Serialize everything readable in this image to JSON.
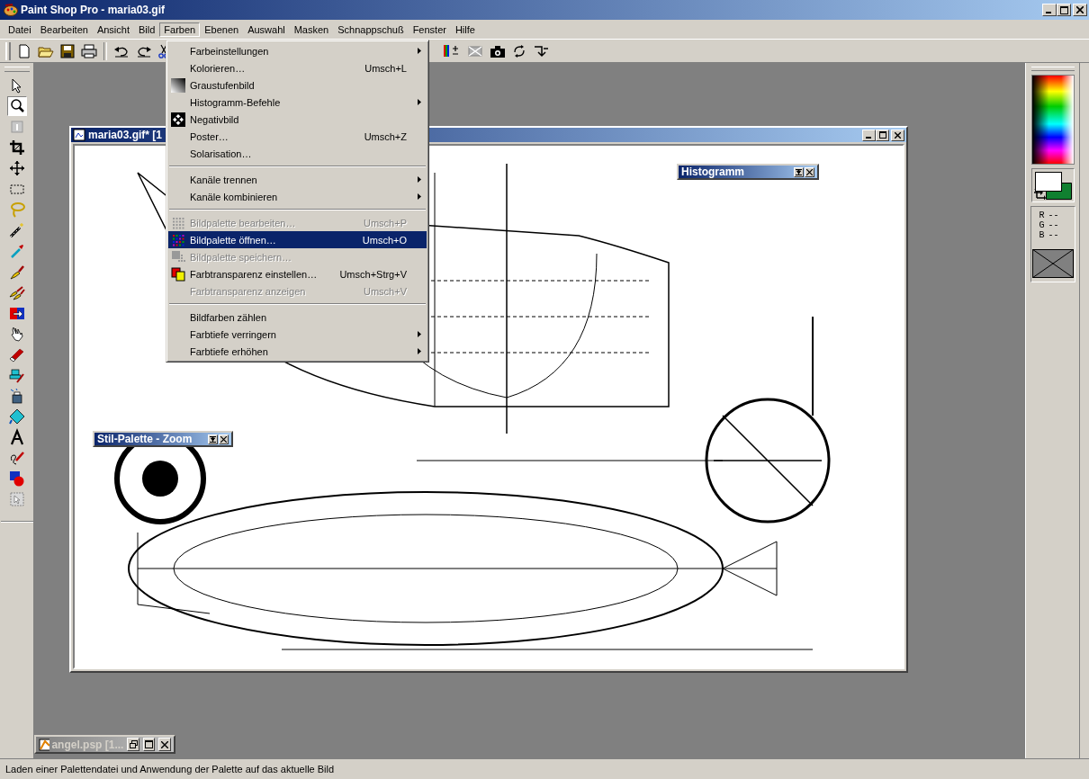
{
  "window": {
    "title": "Paint Shop Pro - maria03.gif"
  },
  "menubar": [
    {
      "label": "Datei",
      "selected": false
    },
    {
      "label": "Bearbeiten",
      "selected": false
    },
    {
      "label": "Ansicht",
      "selected": false
    },
    {
      "label": "Bild",
      "selected": false
    },
    {
      "label": "Farben",
      "selected": true
    },
    {
      "label": "Ebenen",
      "selected": false
    },
    {
      "label": "Auswahl",
      "selected": false
    },
    {
      "label": "Masken",
      "selected": false
    },
    {
      "label": "Schnappschuß",
      "selected": false
    },
    {
      "label": "Fenster",
      "selected": false
    },
    {
      "label": "Hilfe",
      "selected": false
    }
  ],
  "tools": [
    {
      "selected": false
    },
    {
      "selected": true
    },
    {
      "selected": false
    },
    {
      "selected": false
    },
    {
      "selected": false
    },
    {
      "selected": false
    },
    {
      "selected": false
    },
    {
      "selected": false
    },
    {
      "selected": false
    },
    {
      "selected": false
    },
    {
      "selected": false
    },
    {
      "selected": false
    },
    {
      "selected": false
    },
    {
      "selected": false
    },
    {
      "selected": false
    },
    {
      "selected": false
    },
    {
      "selected": false
    },
    {
      "selected": false
    },
    {
      "selected": false
    },
    {
      "selected": false
    },
    {
      "selected": false
    }
  ],
  "menu": [
    {
      "kind": "item",
      "label": "Farbeinstellungen",
      "submenu": true,
      "disabled": false,
      "selected": false
    },
    {
      "kind": "item",
      "label": "Kolorieren…",
      "shortcut": "Umsch+L",
      "submenu": false,
      "disabled": false,
      "selected": false
    },
    {
      "kind": "item",
      "label": "Graustufenbild",
      "submenu": false,
      "disabled": false,
      "selected": false
    },
    {
      "kind": "item",
      "label": "Histogramm-Befehle",
      "submenu": true,
      "disabled": false,
      "selected": false
    },
    {
      "kind": "item",
      "label": "Negativbild",
      "submenu": false,
      "disabled": false,
      "selected": false
    },
    {
      "kind": "item",
      "label": "Poster…",
      "shortcut": "Umsch+Z",
      "submenu": false,
      "disabled": false,
      "selected": false
    },
    {
      "kind": "item",
      "label": "Solarisation…",
      "submenu": false,
      "disabled": false,
      "selected": false
    },
    {
      "kind": "separator"
    },
    {
      "kind": "item",
      "label": "Kanäle trennen",
      "submenu": true,
      "disabled": false,
      "selected": false
    },
    {
      "kind": "item",
      "label": "Kanäle kombinieren",
      "submenu": true,
      "disabled": false,
      "selected": false
    },
    {
      "kind": "separator"
    },
    {
      "kind": "item",
      "label": "Bildpalette bearbeiten…",
      "shortcut": "Umsch+P",
      "submenu": false,
      "disabled": true,
      "selected": false
    },
    {
      "kind": "item",
      "label": "Bildpalette öffnen…",
      "shortcut": "Umsch+O",
      "submenu": false,
      "disabled": false,
      "selected": true
    },
    {
      "kind": "item",
      "label": "Bildpalette speichern…",
      "submenu": false,
      "disabled": true,
      "selected": false
    },
    {
      "kind": "item",
      "label": "Farbtransparenz einstellen…",
      "shortcut": "Umsch+Strg+V",
      "submenu": false,
      "disabled": false,
      "selected": false
    },
    {
      "kind": "item",
      "label": "Farbtransparenz anzeigen",
      "shortcut": "Umsch+V",
      "submenu": false,
      "disabled": true,
      "selected": false
    },
    {
      "kind": "separator"
    },
    {
      "kind": "item",
      "label": "Bildfarben zählen",
      "submenu": false,
      "disabled": false,
      "selected": false
    },
    {
      "kind": "item",
      "label": "Farbtiefe verringern",
      "submenu": true,
      "disabled": false,
      "selected": false
    },
    {
      "kind": "item",
      "label": "Farbtiefe erhöhen",
      "submenu": true,
      "disabled": false,
      "selected": false
    }
  ],
  "document": {
    "title": "maria03.gif* [1"
  },
  "palettes": [
    {
      "title": "Histogramm"
    },
    {
      "title": "Stil-Palette - Zoom"
    }
  ],
  "minimized_window": {
    "title": "angel.psp [1..."
  },
  "color_panel": {
    "readings": [
      {
        "label": "R",
        "value": "--"
      },
      {
        "label": "G",
        "value": "--"
      },
      {
        "label": "B",
        "value": "--"
      }
    ]
  },
  "status_bar": "Laden einer Palettendatei und Anwendung der Palette auf das aktuelle Bild"
}
